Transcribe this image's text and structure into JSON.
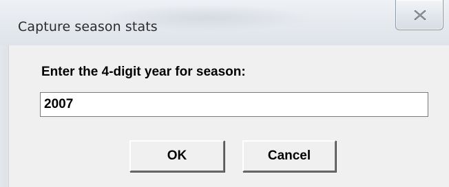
{
  "window": {
    "title": "Capture season stats",
    "close_icon": "close-icon"
  },
  "form": {
    "prompt": "Enter the 4-digit year for season:",
    "year_value": "2007"
  },
  "buttons": {
    "ok_label": "OK",
    "cancel_label": "Cancel"
  }
}
